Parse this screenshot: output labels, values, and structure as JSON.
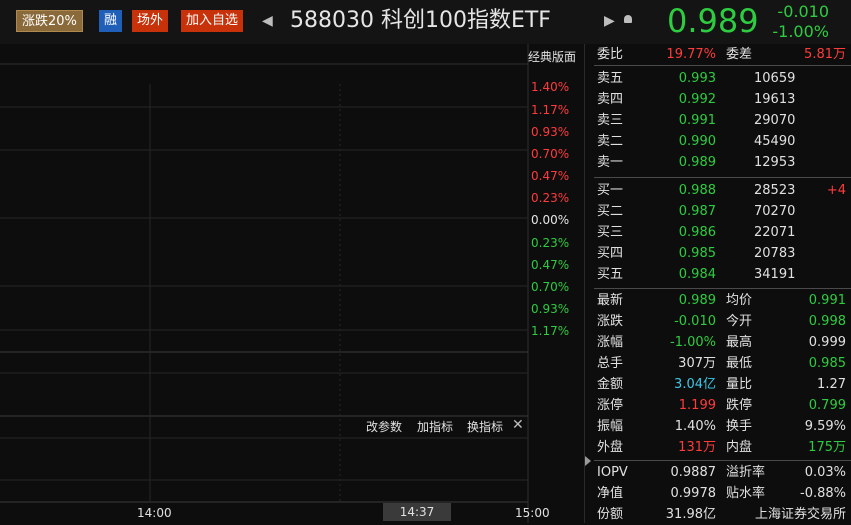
{
  "header": {
    "tag_limit": "涨跌20%",
    "tag_margin": "融",
    "tag_otc": "场外",
    "add_watch": "加入自选",
    "title": "588030 科创100指数ETF",
    "price": "0.989",
    "change": "-0.010",
    "change_pct": "-1.00%"
  },
  "chart": {
    "classic_label": "经典版面",
    "pct_labels": [
      "1.40%",
      "1.17%",
      "0.93%",
      "0.70%",
      "0.47%",
      "0.23%",
      "0.00%",
      "0.23%",
      "0.47%",
      "0.70%",
      "0.93%",
      "1.17%"
    ],
    "indicator_buttons": [
      "改参数",
      "加指标",
      "换指标"
    ],
    "time_labels": [
      "14:00",
      "15:00"
    ],
    "time_cursor": "14:37"
  },
  "committee": {
    "ratio_label": "委比",
    "ratio_value": "19.77%",
    "diff_label": "委差",
    "diff_value": "5.81万"
  },
  "asks": [
    {
      "label": "卖五",
      "price": "0.993",
      "vol": "10659",
      "extra": ""
    },
    {
      "label": "卖四",
      "price": "0.992",
      "vol": "19613",
      "extra": ""
    },
    {
      "label": "卖三",
      "price": "0.991",
      "vol": "29070",
      "extra": ""
    },
    {
      "label": "卖二",
      "price": "0.990",
      "vol": "45490",
      "extra": ""
    },
    {
      "label": "卖一",
      "price": "0.989",
      "vol": "12953",
      "extra": ""
    }
  ],
  "bids": [
    {
      "label": "买一",
      "price": "0.988",
      "vol": "28523",
      "extra": "+4"
    },
    {
      "label": "买二",
      "price": "0.987",
      "vol": "70270",
      "extra": ""
    },
    {
      "label": "买三",
      "price": "0.986",
      "vol": "22071",
      "extra": ""
    },
    {
      "label": "买四",
      "price": "0.985",
      "vol": "20783",
      "extra": ""
    },
    {
      "label": "买五",
      "price": "0.984",
      "vol": "34191",
      "extra": ""
    }
  ],
  "stats": [
    {
      "l1": "最新",
      "v1": "0.989",
      "c1": "g",
      "l2": "均价",
      "v2": "0.991",
      "c2": "g"
    },
    {
      "l1": "涨跌",
      "v1": "-0.010",
      "c1": "g",
      "l2": "今开",
      "v2": "0.998",
      "c2": "g"
    },
    {
      "l1": "涨幅",
      "v1": "-1.00%",
      "c1": "g",
      "l2": "最高",
      "v2": "0.999",
      "c2": "w"
    },
    {
      "l1": "总手",
      "v1": "307万",
      "c1": "w",
      "l2": "最低",
      "v2": "0.985",
      "c2": "g"
    },
    {
      "l1": "金额",
      "v1": "3.04亿",
      "c1": "c",
      "l2": "量比",
      "v2": "1.27",
      "c2": "w"
    },
    {
      "l1": "涨停",
      "v1": "1.199",
      "c1": "r",
      "l2": "跌停",
      "v2": "0.799",
      "c2": "g"
    },
    {
      "l1": "振幅",
      "v1": "1.40%",
      "c1": "w",
      "l2": "换手",
      "v2": "9.59%",
      "c2": "w"
    },
    {
      "l1": "外盘",
      "v1": "131万",
      "c1": "r",
      "l2": "内盘",
      "v2": "175万",
      "c2": "g"
    }
  ],
  "extra_stats": [
    {
      "l1": "IOPV",
      "v1": "0.9887",
      "l2": "溢折率",
      "v2": "0.03%"
    },
    {
      "l1": "净值",
      "v1": "0.9978",
      "l2": "贴水率",
      "v2": "-0.88%"
    },
    {
      "l1": "份额",
      "v1": "31.98亿",
      "l2": "",
      "v2": "上海证券交易所"
    }
  ],
  "colors": {
    "up": "#ff3b3b",
    "down": "#2ecc40",
    "flat": "#e0e0e0",
    "amount": "#3cc8e6"
  }
}
